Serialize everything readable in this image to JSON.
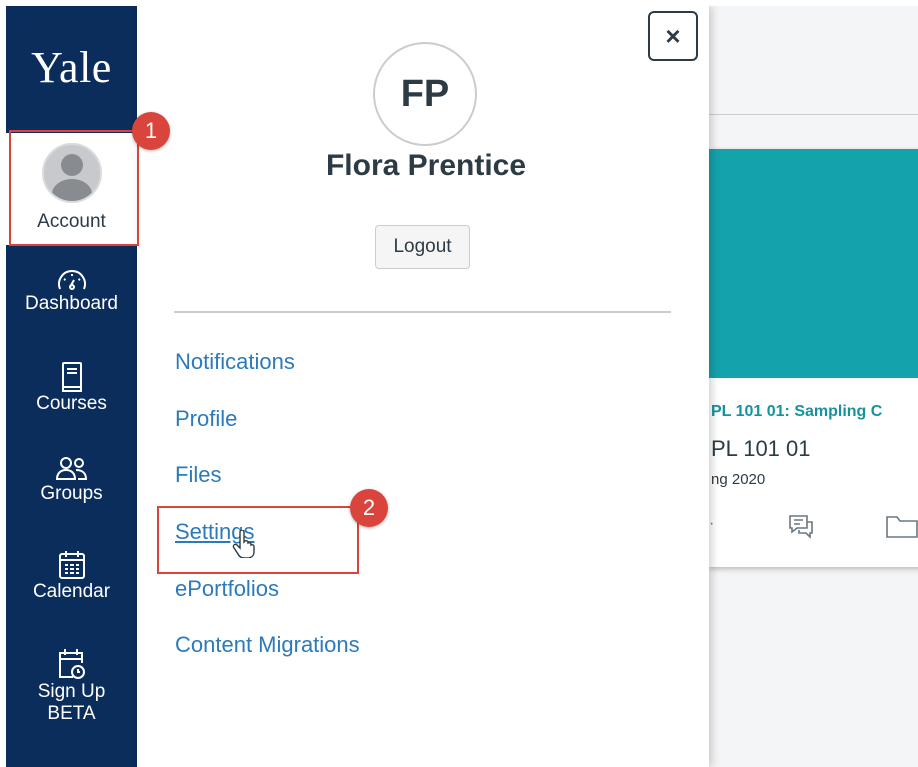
{
  "nav": {
    "logo": "Yale",
    "items": [
      {
        "key": "account",
        "label": "Account",
        "icon": "user-avatar-icon"
      },
      {
        "key": "dashboard",
        "label": "Dashboard",
        "icon": "dashboard-gauge-icon"
      },
      {
        "key": "courses",
        "label": "Courses",
        "icon": "book-icon"
      },
      {
        "key": "groups",
        "label": "Groups",
        "icon": "people-icon"
      },
      {
        "key": "calendar",
        "label": "Calendar",
        "icon": "calendar-icon"
      },
      {
        "key": "signup",
        "label": "Sign Up",
        "label2": "BETA",
        "icon": "calendar-clock-icon"
      }
    ]
  },
  "tray": {
    "close_label": "×",
    "avatar_initials": "FP",
    "user_name": "Flora Prentice",
    "logout_label": "Logout",
    "links": [
      {
        "label": "Notifications"
      },
      {
        "label": "Profile"
      },
      {
        "label": "Files"
      },
      {
        "label": "Settings"
      },
      {
        "label": "ePortfolios"
      },
      {
        "label": "Content Migrations"
      }
    ]
  },
  "course_card": {
    "title": "PL 101 01: Sampling C",
    "code": "PL 101 01",
    "term": "ng 2020",
    "dot": "·",
    "color": "#14a2ad"
  },
  "annotations": {
    "badge1": "1",
    "badge2": "2",
    "color": "#d9453c"
  },
  "colors": {
    "nav_bg": "#0b2d5b",
    "link": "#2b7abc",
    "text": "#2d3b45"
  }
}
